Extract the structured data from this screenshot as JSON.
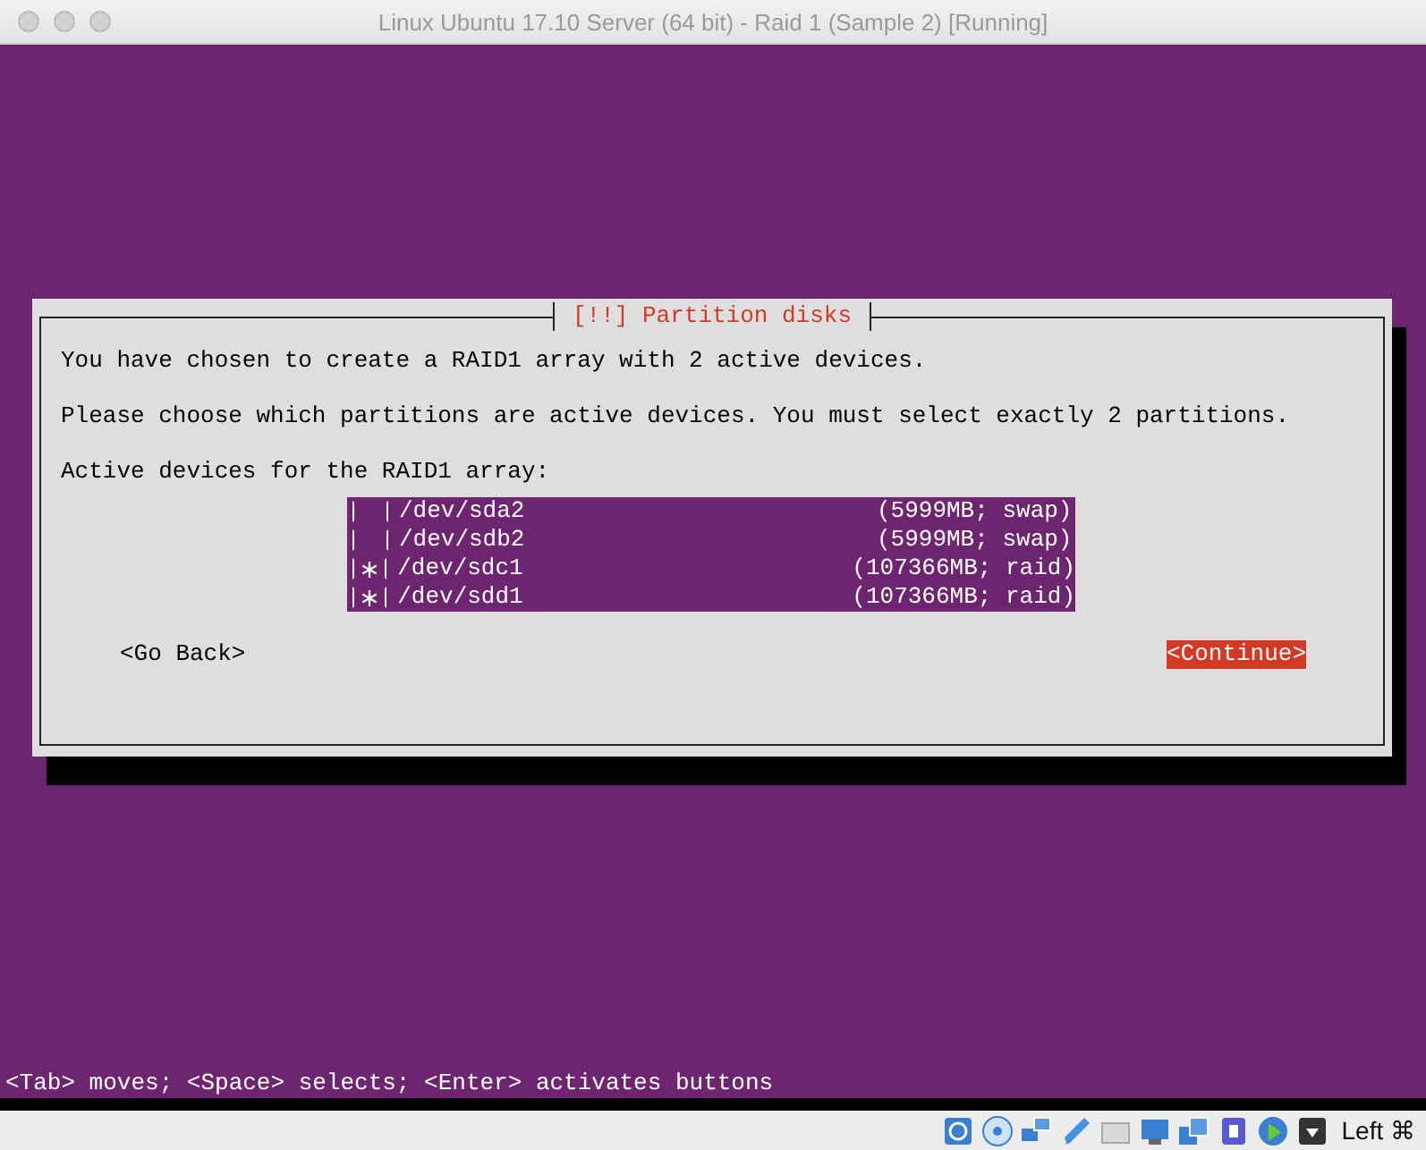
{
  "window": {
    "title": "Linux Ubuntu 17.10 Server (64 bit) - Raid 1 (Sample 2) [Running]"
  },
  "dialog": {
    "title": "[!!] Partition disks",
    "paragraphs": [
      "You have chosen to create a RAID1 array with 2 active devices.",
      "Please choose which partitions are active devices. You must select exactly 2 partitions."
    ],
    "list_label": "Active devices for the RAID1 array:",
    "devices": [
      {
        "checked": false,
        "device": "/dev/sda2",
        "info": "(5999MB; swap)"
      },
      {
        "checked": false,
        "device": "/dev/sdb2",
        "info": "(5999MB; swap)"
      },
      {
        "checked": true,
        "device": "/dev/sdc1",
        "info": "(107366MB; raid)"
      },
      {
        "checked": true,
        "device": "/dev/sdd1",
        "info": "(107366MB; raid)"
      }
    ],
    "buttons": [
      {
        "label": "<Go Back>",
        "selected": false
      },
      {
        "label": "<Continue>",
        "selected": true
      }
    ]
  },
  "help_line": "<Tab> moves; <Space> selects; <Enter> activates buttons",
  "status_bar": {
    "host_key": "Left ⌘"
  }
}
